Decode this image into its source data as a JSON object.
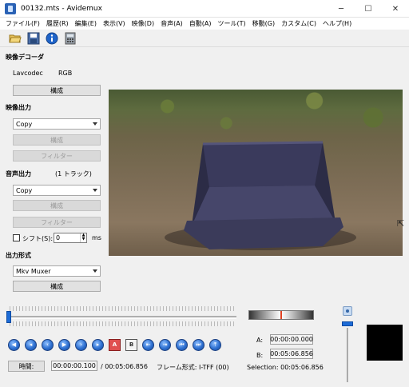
{
  "window": {
    "title": "00132.mts - Avidemux",
    "min": "─",
    "max": "☐",
    "close": "✕"
  },
  "menu": [
    "ファイル(F)",
    "履歴(R)",
    "編集(E)",
    "表示(V)",
    "映像(D)",
    "音声(A)",
    "自動(A)",
    "ツール(T)",
    "移動(G)",
    "カスタム(C)",
    "ヘルプ(H)"
  ],
  "toolbar_icons": [
    "open-icon",
    "save-icon",
    "info-icon",
    "calculator-icon"
  ],
  "video_decoder": {
    "heading": "映像デコーダ",
    "codec": "Lavcodec",
    "format": "RGB",
    "configure": "構成"
  },
  "video_output": {
    "heading": "映像出力",
    "codec": "Copy",
    "configure": "構成",
    "filters": "フィルター"
  },
  "audio_output": {
    "heading": "音声出力",
    "tracks": "(1 トラック)",
    "codec": "Copy",
    "configure": "構成",
    "filters": "フィルター",
    "shift_label": "シフト(S):",
    "shift_value": "0",
    "shift_unit": "ms"
  },
  "output_format": {
    "heading": "出力形式",
    "muxer": "Mkv Muxer",
    "configure": "構成"
  },
  "navigation": {
    "buttons": [
      "prev-keyframe",
      "rewind",
      "previous-frame",
      "play",
      "next-frame",
      "forward",
      "next-keyframe"
    ],
    "marker_a": "A",
    "marker_b": "B"
  },
  "markers": {
    "a_label": "A:",
    "a_value": "00:00:00.000",
    "b_label": "B:",
    "b_value": "00:05:06.856",
    "selection": "Selection: 00:05:06.856"
  },
  "status": {
    "time_button": "時間:",
    "current_time": "00:00:00.100",
    "total_time": "/ 00:05:06.856",
    "frame_type": "フレーム形式: I-TFF (00)"
  },
  "colors": {
    "accent": "#1d6bd6",
    "preview": "#000000"
  }
}
